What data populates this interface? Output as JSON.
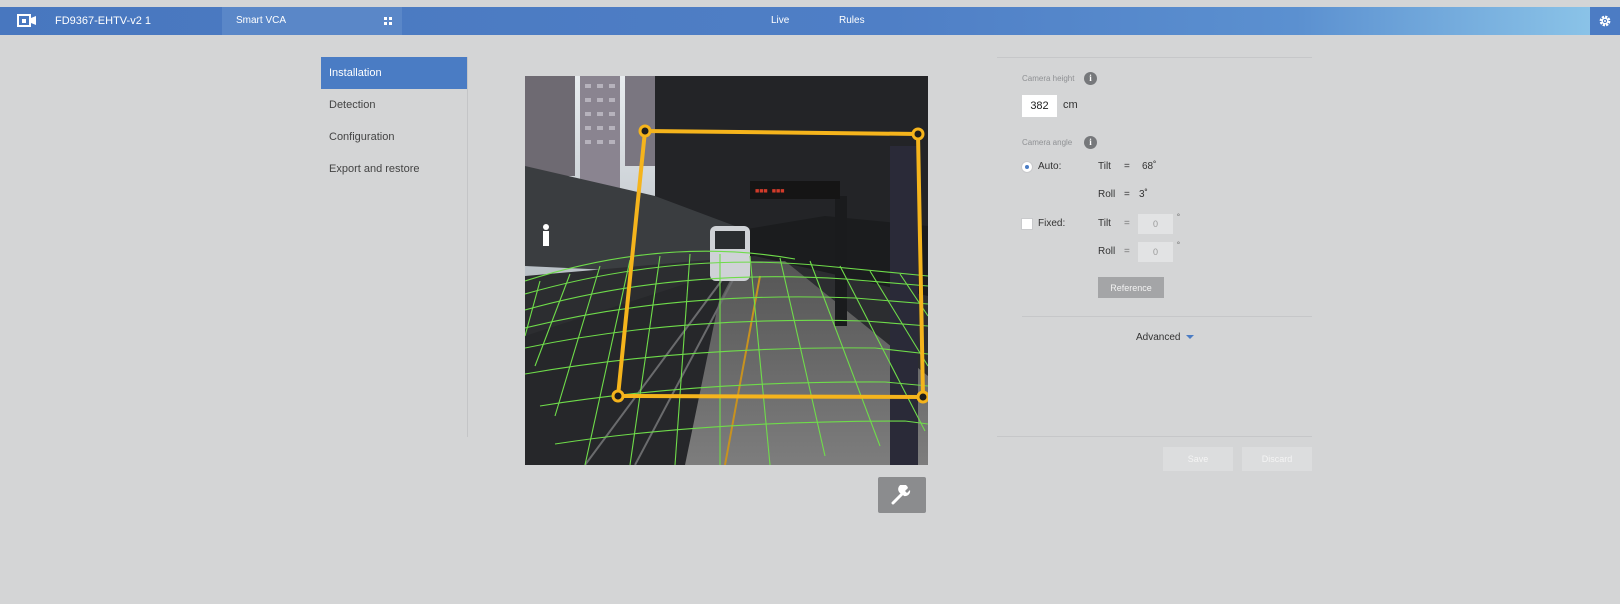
{
  "topbar": {
    "device_name": "FD9367-EHTV-v2 1",
    "app_label": "Smart VCA",
    "nav": {
      "live": "Live",
      "rules": "Rules"
    }
  },
  "sidebar": {
    "items": [
      {
        "label": "Installation",
        "active": true
      },
      {
        "label": "Detection",
        "active": false
      },
      {
        "label": "Configuration",
        "active": false
      },
      {
        "label": "Export and restore",
        "active": false
      }
    ]
  },
  "settings": {
    "camera_height_label": "Camera height",
    "camera_height_value": "382",
    "camera_height_unit": "cm",
    "camera_angle_label": "Camera angle",
    "auto": {
      "label": "Auto:",
      "selected": true,
      "tilt_label": "Tilt",
      "tilt_eq": "=",
      "tilt_value": "68˚",
      "roll_label": "Roll",
      "roll_eq": "=",
      "roll_value": "3˚"
    },
    "fixed": {
      "label": "Fixed:",
      "checked": false,
      "tilt_label": "Tilt",
      "tilt_eq": "=",
      "tilt_value": "0",
      "tilt_unit": "˚",
      "roll_label": "Roll",
      "roll_eq": "=",
      "roll_value": "0",
      "roll_unit": "˚"
    },
    "reference_button": "Reference",
    "advanced_label": "Advanced",
    "save_button": "Save",
    "discard_button": "Discard"
  },
  "colors": {
    "accent": "#4a7cc4",
    "frame_yellow": "#f5b41c",
    "grid_green": "#6fdc4a"
  },
  "icons": [
    "camera-logo-icon",
    "apps-grid-icon",
    "gear-icon",
    "info-icon",
    "wrench-icon",
    "caret-down-icon"
  ]
}
